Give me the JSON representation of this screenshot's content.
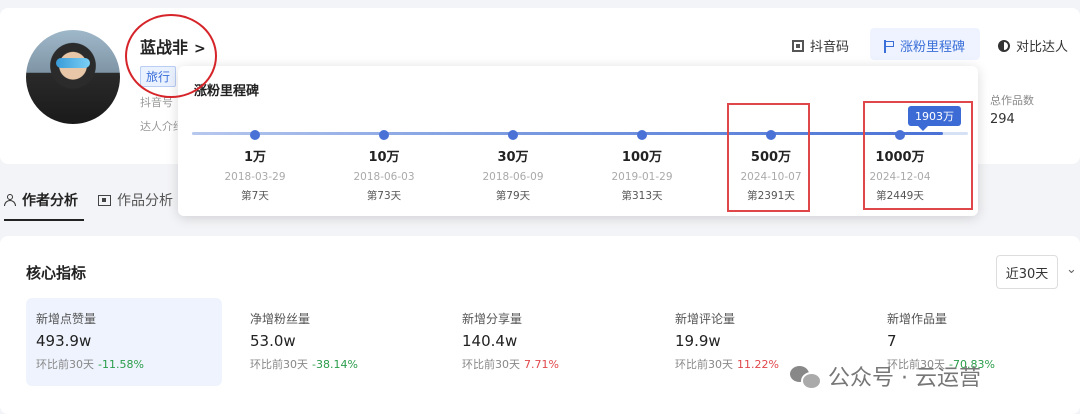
{
  "profile": {
    "name": "蓝战非",
    "name_chevron": ">",
    "tag": "旅行",
    "faint_line1": "抖音号",
    "faint_line2": "达人介绍"
  },
  "top_actions": {
    "douyin_code": "抖音码",
    "fan_milestones": "涨粉里程碑",
    "compare": "对比达人"
  },
  "stats": {
    "total_works_label": "总作品数",
    "total_works_value": "294"
  },
  "milestone_popup": {
    "title": "涨粉里程碑",
    "current_badge": "1903万",
    "progress_fraction": 0.968,
    "milestones": [
      {
        "value": "1万",
        "date": "2018-03-29",
        "day": "第7天"
      },
      {
        "value": "10万",
        "date": "2018-06-03",
        "day": "第73天"
      },
      {
        "value": "30万",
        "date": "2018-06-09",
        "day": "第79天"
      },
      {
        "value": "100万",
        "date": "2019-01-29",
        "day": "第313天"
      },
      {
        "value": "500万",
        "date": "2024-10-07",
        "day": "第2391天"
      },
      {
        "value": "1000万",
        "date": "2024-12-04",
        "day": "第2449天"
      }
    ]
  },
  "tabs": [
    {
      "label": "作者分析",
      "icon": "user-icon",
      "active": true
    },
    {
      "label": "作品分析",
      "icon": "film-icon",
      "active": false
    }
  ],
  "core_metrics": {
    "title": "核心指标",
    "range": "近30天",
    "compare_prefix": "环比前30天",
    "items": [
      {
        "label": "新增点赞量",
        "value": "493.9w",
        "change": "-11.58%",
        "trend": "down"
      },
      {
        "label": "净增粉丝量",
        "value": "53.0w",
        "change": "-38.14%",
        "trend": "down"
      },
      {
        "label": "新增分享量",
        "value": "140.4w",
        "change": "7.71%",
        "trend": "up"
      },
      {
        "label": "新增评论量",
        "value": "19.9w",
        "change": "11.22%",
        "trend": "up"
      },
      {
        "label": "新增作品量",
        "value": "7",
        "change": "-70.83%",
        "trend": "down"
      }
    ]
  },
  "watermark": "公众号 · 云运营",
  "colors": {
    "accent": "#3d6bd6",
    "annotation_red": "#d6252a",
    "down": "#2a9d4b",
    "up": "#e0474b"
  }
}
